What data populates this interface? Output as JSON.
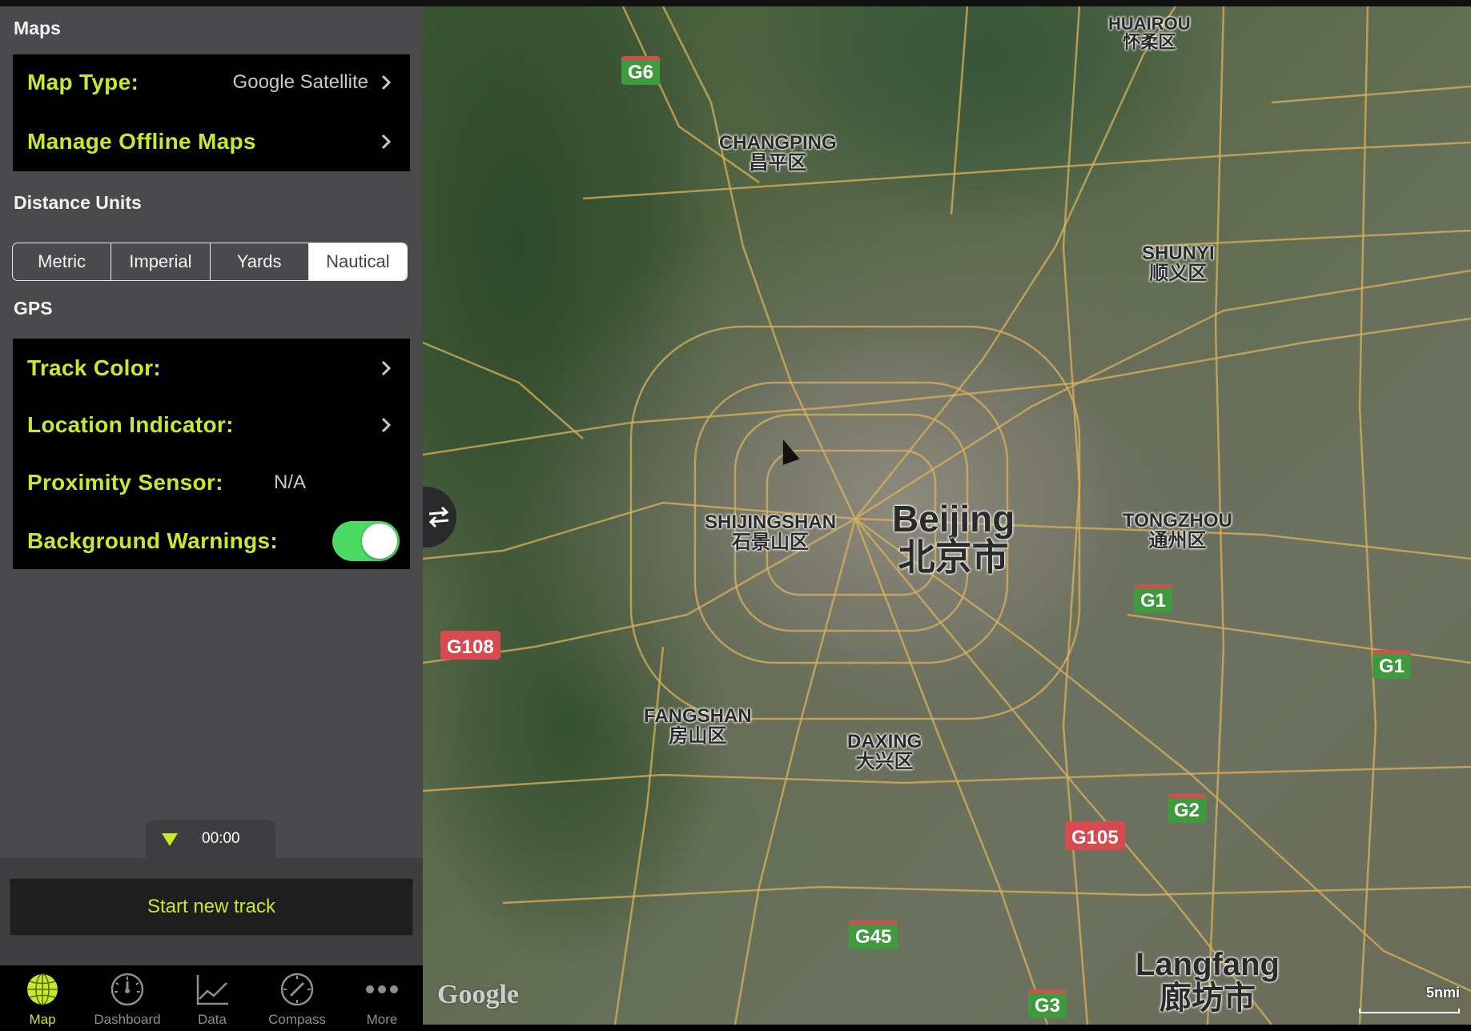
{
  "settings": {
    "maps_section": "Maps",
    "map_type_label": "Map Type:",
    "map_type_value": "Google Satellite",
    "manage_offline_label": "Manage Offline Maps",
    "distance_section": "Distance Units",
    "units": [
      "Metric",
      "Imperial",
      "Yards",
      "Nautical"
    ],
    "selected_unit": "Nautical",
    "gps_section": "GPS",
    "track_color_label": "Track Color:",
    "location_indicator_label": "Location Indicator:",
    "proximity_label": "Proximity Sensor:",
    "proximity_value": "N/A",
    "background_warnings_label": "Background Warnings:",
    "background_warnings_on": true
  },
  "track": {
    "timer": "00:00",
    "start_label": "Start new track"
  },
  "tabs": [
    {
      "label": "Map",
      "icon": "globe-icon",
      "active": true
    },
    {
      "label": "Dashboard",
      "icon": "gauge-icon",
      "active": false
    },
    {
      "label": "Data",
      "icon": "chart-icon",
      "active": false
    },
    {
      "label": "Compass",
      "icon": "compass-icon",
      "active": false
    },
    {
      "label": "More",
      "icon": "more-dots-icon",
      "active": false
    }
  ],
  "map": {
    "places": {
      "huairou_en": "HUAIROU",
      "huairou_cn": "怀柔区",
      "changping_en": "CHANGPING",
      "changping_cn": "昌平区",
      "shunyi_en": "SHUNYI",
      "shunyi_cn": "顺义区",
      "shijingshan_en": "SHIJINGSHAN",
      "shijingshan_cn": "石景山区",
      "beijing_en": "Beijing",
      "beijing_cn": "北京市",
      "tongzhou_en": "TONGZHOU",
      "tongzhou_cn": "通州区",
      "fangshan_en": "FANGSHAN",
      "fangshan_cn": "房山区",
      "daxing_en": "DAXING",
      "daxing_cn": "大兴区",
      "langfang_en": "Langfang",
      "langfang_cn": "廊坊市"
    },
    "shields": {
      "g6": "G6",
      "g1a": "G1",
      "g1b": "G1",
      "g108": "G108",
      "g2": "G2",
      "g105": "G105",
      "g45": "G45",
      "g3": "G3"
    },
    "attribution": "Google",
    "scale_label": "5nmi",
    "colors": {
      "road": "#d9b25a",
      "highway": "#e8c46a",
      "accent": "#c6ea2a"
    }
  }
}
